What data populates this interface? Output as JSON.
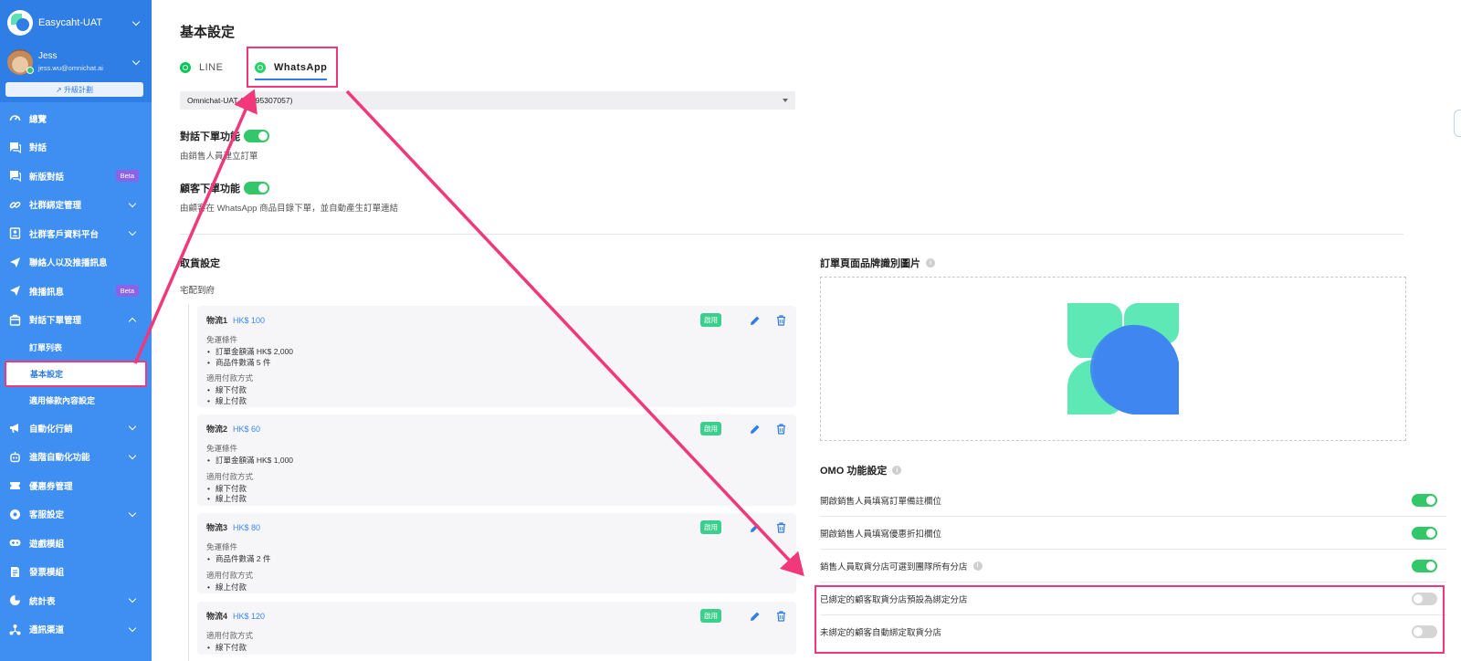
{
  "sidebar": {
    "org_name": "Easycaht-UAT",
    "user_name": "Jess",
    "user_email": "jess.wu@omnichat.ai",
    "upgrade_label": "↗ 升級計劃",
    "items": [
      {
        "label": "總覽",
        "icon": "dashboard-icon"
      },
      {
        "label": "對話",
        "icon": "chat-icon"
      },
      {
        "label": "新版對話",
        "icon": "chat-icon",
        "badge": "Beta"
      },
      {
        "label": "社群綁定管理",
        "icon": "link-icon"
      },
      {
        "label": "社群客戶資料平台",
        "icon": "contacts-icon"
      },
      {
        "label": "聯絡人以及推播訊息",
        "icon": "send-icon"
      },
      {
        "label": "推播訊息",
        "icon": "send-icon",
        "badge": "Beta"
      },
      {
        "label": "對話下單管理",
        "icon": "bag-icon"
      },
      {
        "label": "自動化行銷",
        "icon": "megaphone-icon"
      },
      {
        "label": "進階自動化功能",
        "icon": "robot-icon"
      },
      {
        "label": "優惠券管理",
        "icon": "coupon-icon"
      },
      {
        "label": "客服設定",
        "icon": "headset-icon"
      },
      {
        "label": "遊戲模組",
        "icon": "gamepad-icon"
      },
      {
        "label": "發票模組",
        "icon": "invoice-icon"
      },
      {
        "label": "統計表",
        "icon": "pie-icon"
      },
      {
        "label": "通訊渠道",
        "icon": "channels-icon"
      }
    ],
    "sub_items": [
      "訂單列表",
      "基本設定",
      "適用條款內容設定"
    ]
  },
  "page": {
    "title": "基本設定",
    "tabs": [
      {
        "label": "LINE"
      },
      {
        "label": "WhatsApp"
      }
    ],
    "channel_select": "Omnichat-UAT (85295307057)"
  },
  "features": [
    {
      "title": "對話下單功能",
      "desc": "由銷售人員建立訂單",
      "on": true
    },
    {
      "title": "顧客下單功能",
      "desc": "由顧客在 WhatsApp 商品目錄下單，並自動產生訂單連結",
      "on": true
    }
  ],
  "pickup": {
    "title": "取貨設定",
    "subtitle": "宅配到府",
    "cond_label": "免運條件",
    "pay_label": "適用付款方式",
    "badge": "啟用",
    "cards": [
      {
        "name": "物流1",
        "price": "HK$ 100",
        "conds": [
          "訂單金額滿 HK$ 2,000",
          "商品件數滿 5 件"
        ],
        "pays": [
          "線下付款",
          "線上付款"
        ]
      },
      {
        "name": "物流2",
        "price": "HK$ 60",
        "conds": [
          "訂單金額滿 HK$ 1,000"
        ],
        "pays": [
          "線下付款",
          "線上付款"
        ]
      },
      {
        "name": "物流3",
        "price": "HK$ 80",
        "conds": [
          "商品件數滿 2 件"
        ],
        "pays": [
          "線上付款"
        ]
      },
      {
        "name": "物流4",
        "price": "HK$ 120",
        "conds": [],
        "pays": [
          "線下付款"
        ]
      }
    ]
  },
  "brand": {
    "title": "訂單頁面品牌識別圖片"
  },
  "omo": {
    "title": "OMO 功能設定",
    "rows": [
      {
        "label": "開啟銷售人員填寫訂單備註欄位",
        "on": true
      },
      {
        "label": "開啟銷售人員填寫優惠折扣欄位",
        "on": true
      },
      {
        "label": "銷售人員取貨分店可選到團隊所有分店",
        "on": true,
        "info": true
      },
      {
        "label": "已綁定的顧客取貨分店預設為綁定分店",
        "on": false
      },
      {
        "label": "未綁定的顧客自動綁定取貨分店",
        "on": false
      }
    ]
  },
  "colors": {
    "accent": "#2f7ee6",
    "sidebar": "#3f8ef2",
    "toggle_on": "#34c76a",
    "highlight": "#f0387a"
  }
}
